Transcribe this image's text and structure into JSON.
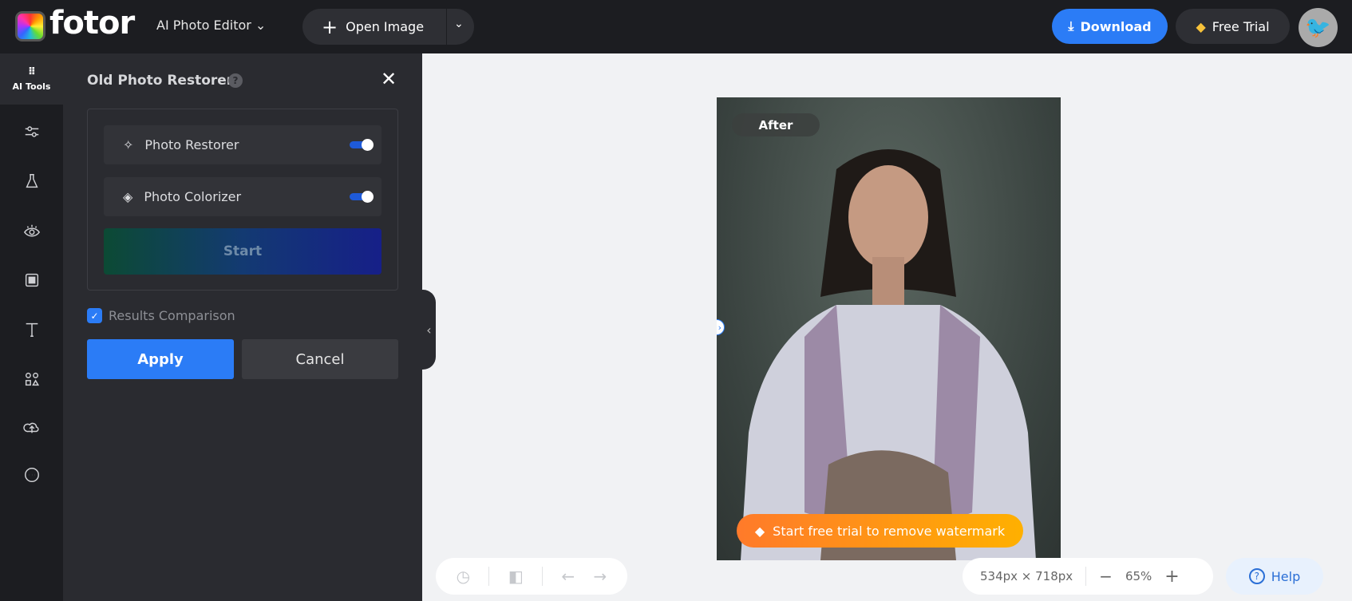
{
  "header": {
    "logo": "fotor",
    "menu_title": "AI Photo Editor",
    "open_image": "Open Image",
    "download": "Download",
    "free_trial": "Free Trial"
  },
  "rail": {
    "items": [
      {
        "label": "AI Tools",
        "icon": "grid-icon"
      },
      {
        "icon": "sliders-icon"
      },
      {
        "icon": "flask-icon"
      },
      {
        "icon": "eye-icon"
      },
      {
        "icon": "frame-icon"
      },
      {
        "icon": "text-icon"
      },
      {
        "icon": "elements-icon"
      },
      {
        "icon": "upload-cloud-icon"
      },
      {
        "icon": "more-icon"
      }
    ]
  },
  "panel": {
    "title": "Old Photo Restorer",
    "options": [
      {
        "label": "Photo Restorer",
        "enabled": true
      },
      {
        "label": "Photo Colorizer",
        "enabled": true
      }
    ],
    "start": "Start",
    "comparison_label": "Results Comparison",
    "comparison_checked": true,
    "apply": "Apply",
    "cancel": "Cancel"
  },
  "canvas": {
    "after_label": "After",
    "watermark": "Start free trial to remove watermark"
  },
  "footer": {
    "dimensions": "534px × 718px",
    "zoom": "65%",
    "help": "Help"
  },
  "colors": {
    "accent": "#2b7cf6",
    "topbar": "#1c1d21",
    "panel": "#2a2b30",
    "watermark": "#ff9a1a"
  }
}
